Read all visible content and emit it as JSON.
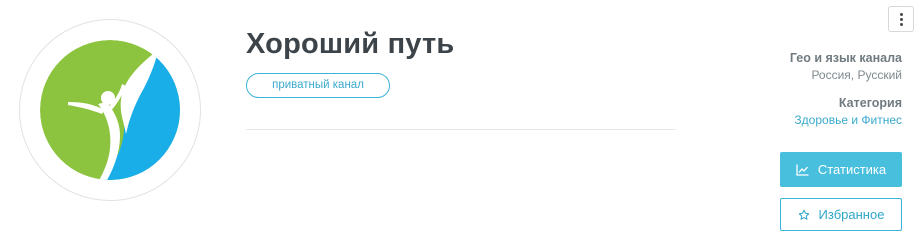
{
  "channel": {
    "title": "Хороший путь",
    "privacy_badge": "приватный канал"
  },
  "info": {
    "geo_label": "Гео и язык канала",
    "geo_value": "Россия, Русский",
    "category_label": "Категория",
    "category_value": "Здоровье и Фитнес"
  },
  "actions": {
    "stats_label": "Статистика",
    "stats_icon": "line-chart-icon",
    "favorite_label": "Избранное",
    "favorite_icon": "star-outline-icon",
    "menu_icon": "vertical-dots-icon"
  },
  "colors": {
    "accent": "#49bfde",
    "logo_green": "#8cc43f",
    "logo_blue": "#1aaee8",
    "title": "#3d4449"
  }
}
